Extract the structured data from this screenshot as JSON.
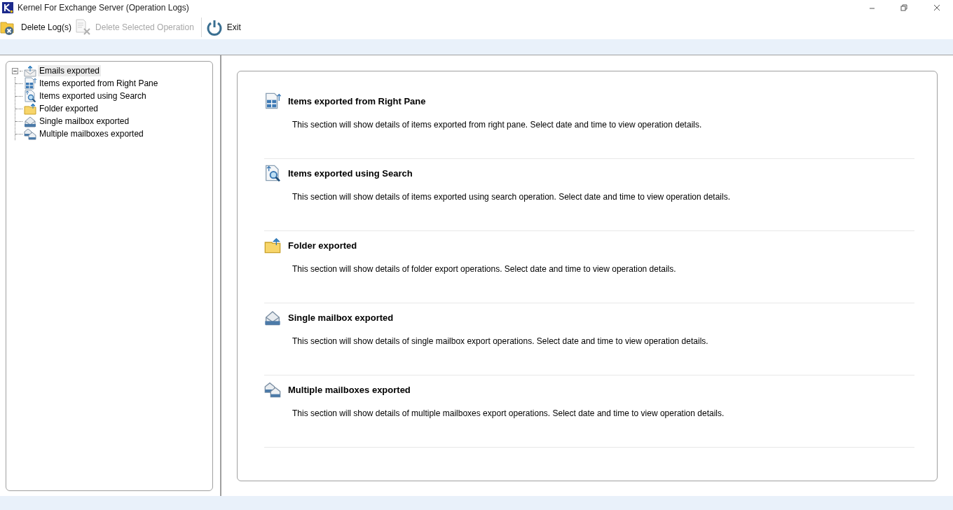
{
  "window": {
    "title": "Kernel For Exchange Server (Operation Logs)"
  },
  "toolbar": [
    {
      "kind": "delete-log",
      "label": "Delete Log(s)",
      "disabled": false
    },
    {
      "kind": "delete-operation",
      "label": "Delete Selected Operation",
      "disabled": true
    },
    {
      "kind": "exit",
      "label": "Exit",
      "disabled": false
    }
  ],
  "tree": {
    "label": "Emails exported",
    "kind": "mail-upload",
    "expanded": true,
    "selected": true,
    "children": [
      {
        "label": "Items exported from Right Pane",
        "kind": "pane",
        "selected": false
      },
      {
        "label": "Items exported using Search",
        "kind": "search",
        "selected": false
      },
      {
        "label": "Folder exported",
        "kind": "folder",
        "selected": false
      },
      {
        "label": "Single mailbox exported",
        "kind": "mailbox",
        "selected": false
      },
      {
        "label": "Multiple mailboxes exported",
        "kind": "mailboxes",
        "selected": false
      }
    ]
  },
  "sections": [
    {
      "kind": "pane",
      "title": "Items exported from Right Pane",
      "description": "This section will show details of items exported from right pane. Select date and time to view operation details."
    },
    {
      "kind": "search",
      "title": "Items exported using Search",
      "description": "This section will show details of items exported using search operation. Select date and time to view operation details."
    },
    {
      "kind": "folder",
      "title": "Folder exported",
      "description": "This section will show details of folder export operations. Select date and time to view operation details."
    },
    {
      "kind": "mailbox",
      "title": "Single mailbox exported",
      "description": "This section will show details of single mailbox export operations. Select date and time to view operation details."
    },
    {
      "kind": "mailboxes",
      "title": "Multiple mailboxes exported",
      "description": "This section will show details of multiple mailboxes export operations. Select date and time to view operation details."
    }
  ]
}
